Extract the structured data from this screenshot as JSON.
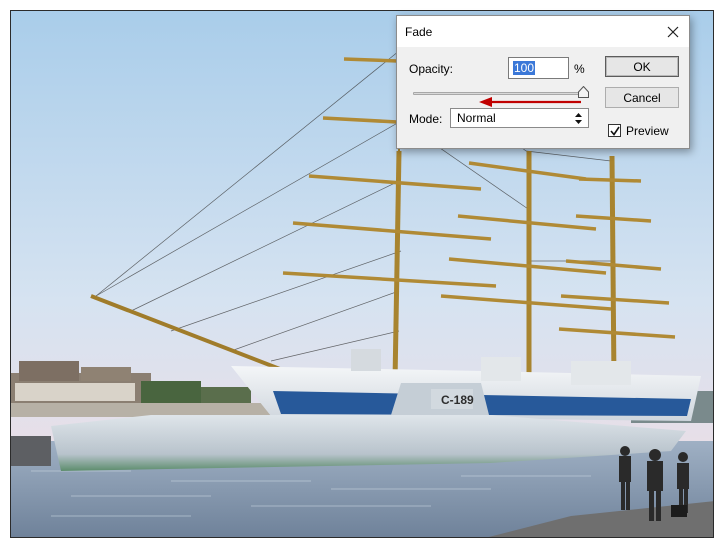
{
  "dialog": {
    "title": "Fade",
    "opacity_label": "Opacity:",
    "opacity_value": "100",
    "opacity_unit": "%",
    "opacity_fraction": 1.0,
    "mode_label": "Mode:",
    "mode_value": "Normal",
    "ok_label": "OK",
    "cancel_label": "Cancel",
    "preview_label": "Preview",
    "preview_checked": true
  },
  "photo": {
    "submarine_number": "C-189"
  },
  "icons": {
    "close": "close-icon",
    "select_arrows": "updown-arrow-icon",
    "checkmark": "checkmark-icon",
    "annotation": "red-arrow-icon"
  },
  "colors": {
    "annotation_arrow": "#c00000",
    "selection": "#3b78d8"
  }
}
